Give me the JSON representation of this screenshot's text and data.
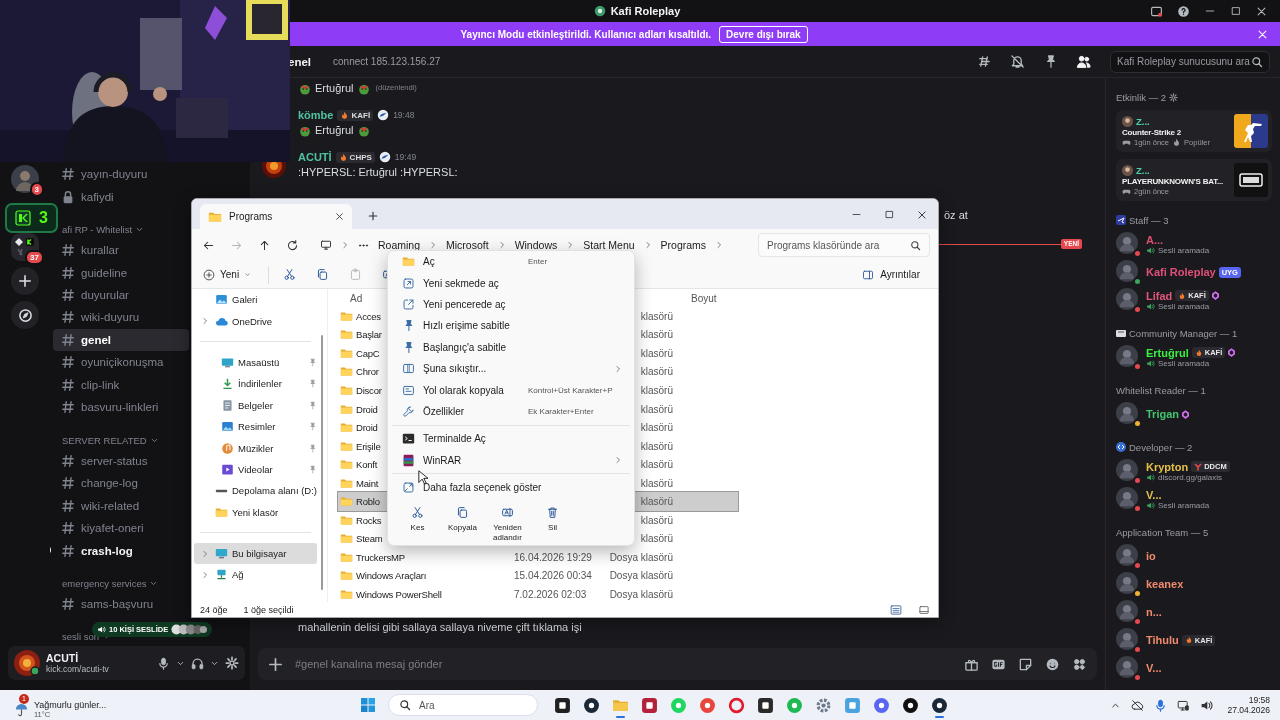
{
  "window": {
    "title": "Kafi Roleplay"
  },
  "banner": {
    "text": "Yayıncı Modu etkinleştirildi. Kullanıcı adları kısaltıldı.",
    "button": "Devre dışı bırak"
  },
  "overlay": {
    "badge": "3",
    "voice_pill": "10 KİŞİ SESLİDE"
  },
  "server_rail": [
    {
      "kind": "avatar",
      "badge": "3"
    },
    {
      "kind": "gap"
    },
    {
      "kind": "folder",
      "badge": "37"
    },
    {
      "kind": "add"
    },
    {
      "kind": "discover"
    }
  ],
  "channels": [
    {
      "kind": "text",
      "name": "yayın-duyuru",
      "selected": false,
      "unread": false
    },
    {
      "kind": "locked",
      "name": "kafiydi",
      "selected": false,
      "unread": false
    },
    {
      "kind": "category",
      "name": "afi RP - Whitelist"
    },
    {
      "kind": "text",
      "name": "kurallar",
      "selected": false,
      "unread": false
    },
    {
      "kind": "text",
      "name": "guideline",
      "selected": false,
      "unread": false
    },
    {
      "kind": "text",
      "name": "duyurular",
      "selected": false,
      "unread": false
    },
    {
      "kind": "text",
      "name": "wiki-duyuru",
      "selected": false,
      "unread": false
    },
    {
      "kind": "text",
      "name": "genel",
      "selected": true,
      "unread": false
    },
    {
      "kind": "text",
      "name": "oyuniçikonuşma",
      "selected": false,
      "unread": false
    },
    {
      "kind": "text",
      "name": "clip-link",
      "selected": false,
      "unread": false
    },
    {
      "kind": "text",
      "name": "basvuru-linkleri",
      "selected": false,
      "unread": false
    },
    {
      "kind": "category",
      "name": "SERVER RELATED"
    },
    {
      "kind": "text",
      "name": "server-status",
      "selected": false,
      "unread": false
    },
    {
      "kind": "text",
      "name": "change-log",
      "selected": false,
      "unread": false
    },
    {
      "kind": "text",
      "name": "wiki-related",
      "selected": false,
      "unread": false
    },
    {
      "kind": "text",
      "name": "kiyafet-oneri",
      "selected": false,
      "unread": false
    },
    {
      "kind": "text",
      "name": "crash-log",
      "selected": false,
      "unread": true
    },
    {
      "kind": "category",
      "name": "emergency services"
    },
    {
      "kind": "text",
      "name": "sams-başvuru",
      "selected": false,
      "unread": false
    },
    {
      "kind": "category",
      "name": "sesli soh"
    }
  ],
  "user_panel": {
    "name": "ACUTİ",
    "status_text": "kick.com/acuti-tv"
  },
  "chat": {
    "channel": "enel",
    "topic": "connect 185.123.156.27",
    "search_placeholder": "Kafi Roleplay sunucusunu ara",
    "messages": [
      {
        "kind": "continuation",
        "text": "Ertuğrul",
        "emoji": true,
        "edited": "(düzenlendi)"
      },
      {
        "kind": "full",
        "author": "kömbe",
        "color": "#4fc3a1",
        "tag": "KAFİ",
        "time": "19:48",
        "text": "Ertuğrul",
        "emoji": true,
        "avatar": false
      },
      {
        "kind": "full",
        "author": "ACUTİ",
        "color": "#4fc3a1",
        "tag": "CHPS",
        "time": "19:49",
        "text": ":HYPERSL: Ertuğrul :HYPERSL:",
        "emoji": false,
        "avatar": true
      }
    ],
    "peek_text": "öz at",
    "new_marker": "YENİ",
    "last_line": "mahallenin delisi gibi sallaya sallaya niveme çift tıklama işi",
    "input_placeholder": "#genel kanalına mesaj gönder"
  },
  "member_list": {
    "activity_title": "Etkinlik — 2",
    "activities": [
      {
        "kind": "shooter",
        "user": "Z...",
        "game": "Counter-Strike 2",
        "time": "1gün önce",
        "extra": "Popüler"
      },
      {
        "kind": "dark",
        "user": "Z...",
        "game": "PLAYERUNKNOWN'S BAT...",
        "time": "2gün önce"
      }
    ],
    "groups": [
      {
        "title": "Staff — 3",
        "kind": "plane",
        "members": [
          {
            "name": "A...",
            "color": "#dc4f72",
            "kind": "dnd",
            "activity": "Sesli aramada"
          },
          {
            "name": "Kafi Roleplay",
            "color": "#e2507a",
            "kind": "online",
            "tag": {
              "text": "UYG",
              "kind": "app"
            }
          },
          {
            "name": "Lifad",
            "color": "#e0577a",
            "kind": "dnd",
            "tag": {
              "text": "KAFİ",
              "kind": "guild"
            },
            "boost": true,
            "activity": "Sesli aramada"
          }
        ]
      },
      {
        "title": "Community Manager — 1",
        "kind": "card",
        "members": [
          {
            "name": "Ertuğrul",
            "color": "#3cf040",
            "kind": "dnd",
            "tag": {
              "text": "KAFİ",
              "kind": "guild"
            },
            "boost": true,
            "activity": "Sesli aramada"
          }
        ]
      },
      {
        "title": "Whitelist Reader — 1",
        "members": [
          {
            "name": "Trigan",
            "color": "#43c46e",
            "kind": "idle",
            "boost": true
          }
        ]
      },
      {
        "title": "Developer — 2",
        "kind": "code",
        "members": [
          {
            "name": "Krypton",
            "color": "#e5c04a",
            "kind": "dnd",
            "tag": {
              "text": "DDCM",
              "kind": "mark"
            },
            "activity": "discord.gg/galaxis"
          },
          {
            "name": "V...",
            "color": "#e0c04a",
            "kind": "dnd",
            "activity": "Sesli aramada"
          }
        ]
      },
      {
        "title": "Application Team — 5",
        "members": [
          {
            "name": "io",
            "color": "#f08a6c",
            "kind": "dnd"
          },
          {
            "name": "keanex",
            "color": "#f08a6c",
            "kind": "idle"
          },
          {
            "name": "n...",
            "color": "#f08a6c",
            "kind": "dnd"
          },
          {
            "name": "Tihulu",
            "color": "#f08a6c",
            "kind": "dnd",
            "tag": {
              "text": "KAFİ",
              "kind": "guild"
            }
          },
          {
            "name": "V...",
            "color": "#f08a6c",
            "kind": "dnd"
          }
        ]
      }
    ]
  },
  "explorer": {
    "tab": "Programs",
    "breadcrumb": [
      "Roaming",
      "Microsoft",
      "Windows",
      "Start Menu",
      "Programs"
    ],
    "search_placeholder": "Programs klasöründe ara",
    "new_button": "Yeni",
    "details_button": "Ayrıntılar",
    "nav": [
      [
        {
          "label": "Galeri",
          "kind": "gallery",
          "expandable": false,
          "pinned": false,
          "selected": false
        },
        {
          "label": "OneDrive",
          "kind": "cloud",
          "expandable": true,
          "pinned": false,
          "selected": false
        }
      ],
      [
        {
          "label": "Masaüstü",
          "kind": "desktop",
          "expandable": false,
          "pinned": true,
          "selected": false
        },
        {
          "label": "İndirilenler",
          "kind": "download",
          "expandable": false,
          "pinned": true,
          "selected": false
        },
        {
          "label": "Belgeler",
          "kind": "docs",
          "expandable": false,
          "pinned": true,
          "selected": false
        },
        {
          "label": "Resimler",
          "kind": "pictures",
          "expandable": false,
          "pinned": true,
          "selected": false
        },
        {
          "label": "Müzikler",
          "kind": "music",
          "expandable": false,
          "pinned": true,
          "selected": false
        },
        {
          "label": "Videolar",
          "kind": "video",
          "expandable": false,
          "pinned": true,
          "selected": false
        },
        {
          "label": "Depolama alanı (D:)",
          "kind": "drive",
          "expandable": false,
          "pinned": false,
          "selected": false
        },
        {
          "label": "Yeni klasör",
          "kind": "folder",
          "expandable": false,
          "pinned": false,
          "selected": false
        }
      ],
      [
        {
          "label": "Bu bilgisayar",
          "kind": "pc",
          "expandable": true,
          "pinned": false,
          "selected": true
        },
        {
          "label": "Ağ",
          "kind": "network",
          "expandable": true,
          "pinned": false,
          "selected": false
        }
      ]
    ],
    "columns": {
      "name": "Ad",
      "size": "Boyut"
    },
    "files": [
      {
        "name": "Acces",
        "type": "klasörü",
        "selected": false
      },
      {
        "name": "Başlar",
        "type": "klasörü",
        "selected": false
      },
      {
        "name": "CapC",
        "type": "klasörü",
        "selected": false
      },
      {
        "name": "Chror",
        "type": "klasörü",
        "selected": false
      },
      {
        "name": "Discor",
        "type": "klasörü",
        "selected": false
      },
      {
        "name": "Droid",
        "type": "klasörü",
        "selected": false
      },
      {
        "name": "Droid",
        "type": "klasörü",
        "selected": false
      },
      {
        "name": "Erişile",
        "type": "klasörü",
        "selected": false
      },
      {
        "name": "Konft",
        "type": "klasörü",
        "selected": false
      },
      {
        "name": "Maint",
        "type": "klasörü",
        "selected": false
      },
      {
        "name": "Roblo",
        "type": "klasörü",
        "selected": true
      },
      {
        "name": "Rocks",
        "type": "klasörü",
        "selected": false
      },
      {
        "name": "Steam",
        "type": "klasörü",
        "selected": false
      },
      {
        "name": "TruckersMP",
        "date": "16.04.2026 19:29",
        "type": "Dosya klasörü",
        "selected": false
      },
      {
        "name": "Windows Araçları",
        "date": "15.04.2026 00:34",
        "type": "Dosya klasörü",
        "selected": false
      },
      {
        "name": "Windows PowerShell",
        "date": "7.02.2026 02:03",
        "type": "Dosya klasörü",
        "selected": false
      }
    ],
    "status": [
      "24 öğe",
      "1 öğe seçildi"
    ]
  },
  "context_menu": {
    "sections": [
      [
        {
          "kind": "folder",
          "label": "Aç",
          "shortcut": "Enter"
        },
        {
          "kind": "newtab",
          "label": "Yeni sekmede aç"
        },
        {
          "kind": "newwindow",
          "label": "Yeni pencerede aç"
        },
        {
          "kind": "pin",
          "label": "Hızlı erişime sabitle"
        },
        {
          "kind": "pin",
          "label": "Başlangıç'a sabitle"
        },
        {
          "kind": "zip",
          "label": "Şuna sıkıştır...",
          "submenu": true
        },
        {
          "kind": "path",
          "label": "Yol olarak kopyala",
          "shortcut": "Kontrol+Üst Karakter+P"
        },
        {
          "kind": "wrench",
          "label": "Özellikler",
          "shortcut": "Ek Karakter+Enter"
        }
      ],
      [
        {
          "kind": "terminal",
          "label": "Terminalde Aç"
        },
        {
          "kind": "winrar",
          "label": "WinRAR",
          "submenu": true
        }
      ],
      [
        {
          "kind": "more",
          "label": "Daha fazla seçenek göster"
        }
      ]
    ],
    "actions": [
      {
        "kind": "cut",
        "label": "Kes"
      },
      {
        "kind": "copy",
        "label": "Kopyala"
      },
      {
        "kind": "rename",
        "label": "Yeniden adlandır"
      },
      {
        "kind": "trash",
        "label": "Sil"
      }
    ]
  },
  "taskbar": {
    "weather": {
      "title": "Yağmurlu günler...",
      "temp": "11°C",
      "badge": "1"
    },
    "search": "Ara",
    "apps": [
      {
        "kind": "square",
        "color": "#202020",
        "running": false
      },
      {
        "kind": "circle",
        "color": "#1b2838",
        "running": false
      },
      {
        "kind": "folder",
        "color": "#f5c84c",
        "running": true
      },
      {
        "kind": "square",
        "color": "#b3213a",
        "running": false
      },
      {
        "kind": "circle",
        "color": "#1ed760",
        "running": false
      },
      {
        "kind": "circle",
        "color": "#e8453c",
        "running": false
      },
      {
        "kind": "ring",
        "color": "#e3192e",
        "running": false
      },
      {
        "kind": "square",
        "color": "#2a2a2a",
        "running": false
      },
      {
        "kind": "circle",
        "color": "#1db954",
        "running": false
      },
      {
        "kind": "gear",
        "color": "#6a7a8c",
        "running": false
      },
      {
        "kind": "square",
        "color": "#4aa3df",
        "running": false
      },
      {
        "kind": "circle",
        "color": "#5865f2",
        "running": false
      },
      {
        "kind": "circle",
        "color": "#111111",
        "running": false
      },
      {
        "kind": "circle",
        "color": "#1b2838",
        "running": true
      }
    ],
    "time": "19:58",
    "date": "27.04.2026"
  }
}
